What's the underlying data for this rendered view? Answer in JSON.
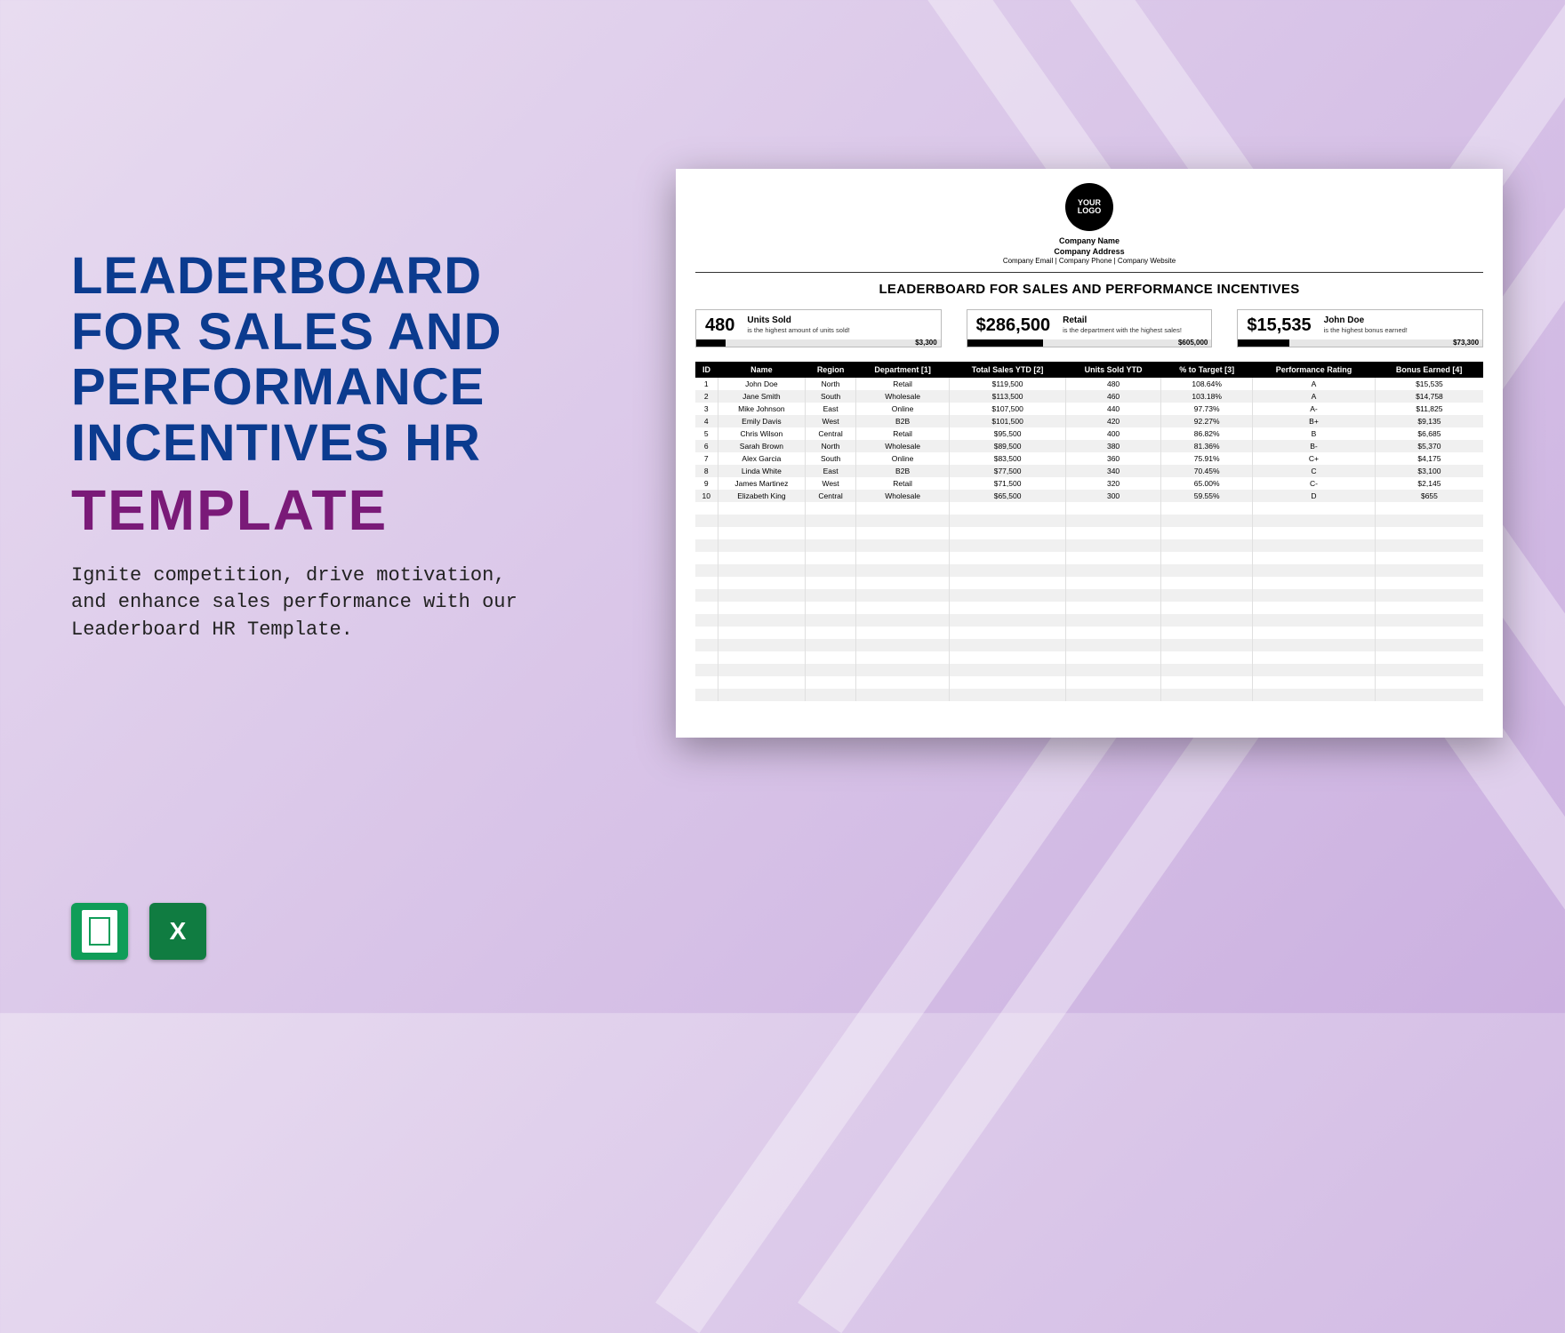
{
  "promo": {
    "title_line1": "Leaderboard",
    "title_line2": "for Sales and",
    "title_line3": "Performance",
    "title_line4": "Incentives HR",
    "title_template": "Template",
    "tagline": "Ignite competition, drive motivation, and enhance sales performance with our Leaderboard HR Template."
  },
  "formats": {
    "sheets_name": "google-sheets-icon",
    "excel_name": "excel-icon",
    "excel_letter": "X"
  },
  "doc": {
    "logo_text": "YOUR LOGO",
    "company_name": "Company Name",
    "company_address": "Company Address",
    "company_contact": "Company Email | Company Phone | Company Website",
    "title": "LEADERBOARD FOR SALES AND PERFORMANCE INCENTIVES",
    "stats": [
      {
        "value": "480",
        "label": "Units Sold",
        "desc": "is the highest amount of units sold!",
        "pct": "12.21%",
        "max": "$3,300",
        "fill_pct": 12
      },
      {
        "value": "$286,500",
        "label": "Retail",
        "desc": "is the department with the highest sales!",
        "pct": "30.97%",
        "max": "$605,000",
        "fill_pct": 31
      },
      {
        "value": "$15,535",
        "label": "John Doe",
        "desc": "is the highest bonus earned!",
        "pct": "21.17%",
        "max": "$73,300",
        "fill_pct": 21
      }
    ],
    "columns": [
      "ID",
      "Name",
      "Region",
      "Department [1]",
      "Total Sales YTD [2]",
      "Units Sold YTD",
      "% to Target [3]",
      "Performance Rating",
      "Bonus Earned [4]"
    ],
    "rows": [
      [
        "1",
        "John Doe",
        "North",
        "Retail",
        "$119,500",
        "480",
        "108.64%",
        "A",
        "$15,535"
      ],
      [
        "2",
        "Jane Smith",
        "South",
        "Wholesale",
        "$113,500",
        "460",
        "103.18%",
        "A",
        "$14,758"
      ],
      [
        "3",
        "Mike Johnson",
        "East",
        "Online",
        "$107,500",
        "440",
        "97.73%",
        "A-",
        "$11,825"
      ],
      [
        "4",
        "Emily Davis",
        "West",
        "B2B",
        "$101,500",
        "420",
        "92.27%",
        "B+",
        "$9,135"
      ],
      [
        "5",
        "Chris Wilson",
        "Central",
        "Retail",
        "$95,500",
        "400",
        "86.82%",
        "B",
        "$6,685"
      ],
      [
        "6",
        "Sarah Brown",
        "North",
        "Wholesale",
        "$89,500",
        "380",
        "81.36%",
        "B-",
        "$5,370"
      ],
      [
        "7",
        "Alex Garcia",
        "South",
        "Online",
        "$83,500",
        "360",
        "75.91%",
        "C+",
        "$4,175"
      ],
      [
        "8",
        "Linda White",
        "East",
        "B2B",
        "$77,500",
        "340",
        "70.45%",
        "C",
        "$3,100"
      ],
      [
        "9",
        "James Martinez",
        "West",
        "Retail",
        "$71,500",
        "320",
        "65.00%",
        "C-",
        "$2,145"
      ],
      [
        "10",
        "Elizabeth King",
        "Central",
        "Wholesale",
        "$65,500",
        "300",
        "59.55%",
        "D",
        "$655"
      ]
    ],
    "empty_rows": 16
  }
}
